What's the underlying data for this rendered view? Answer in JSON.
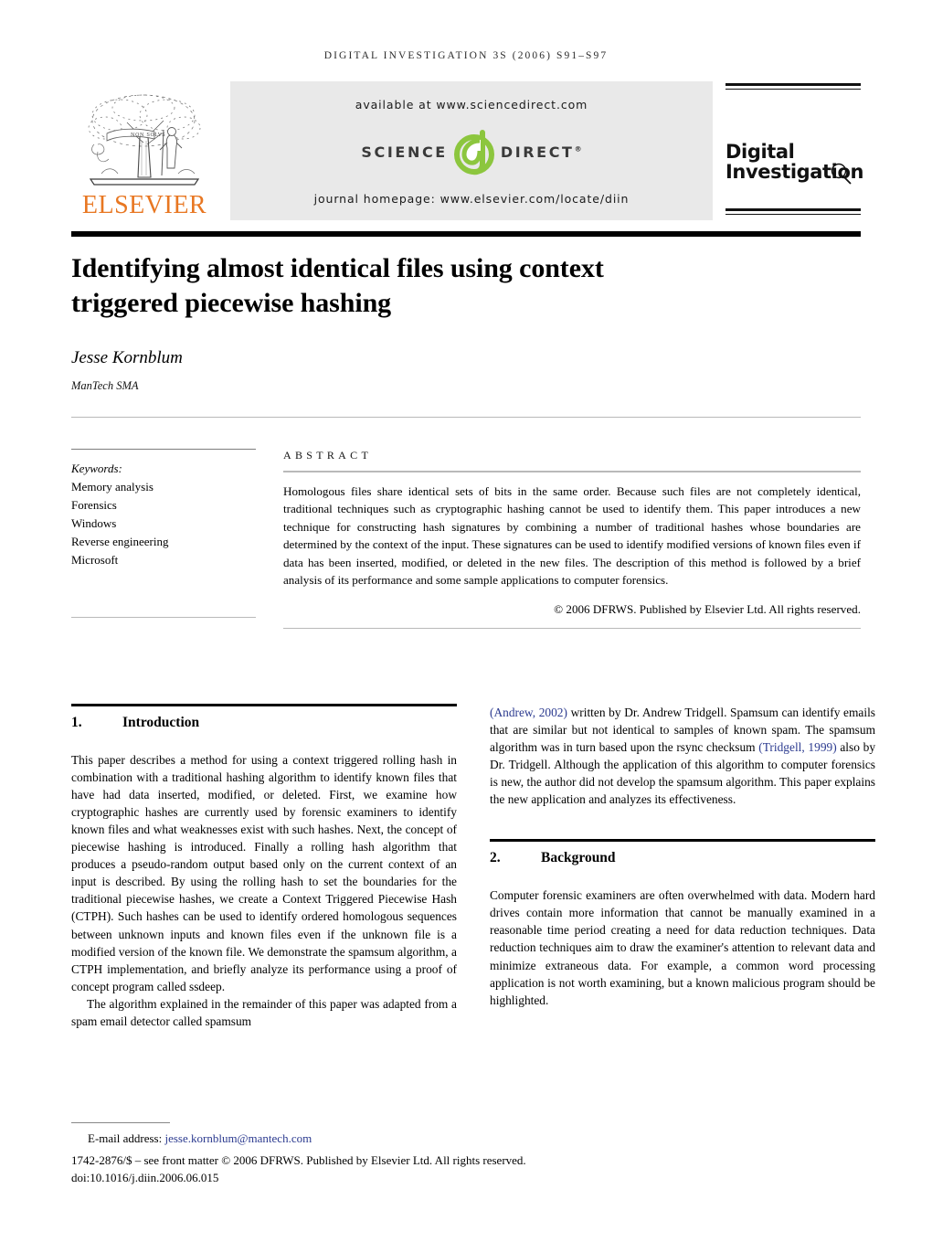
{
  "running_head": "DIGITAL INVESTIGATION 3S (2006) S91–S97",
  "masthead": {
    "elsevier_wordmark": "ELSEVIER",
    "elsevier_motto": "NON SOLVS",
    "available_at": "available at www.sciencedirect.com",
    "sciencedirect_left": "SCIENCE",
    "sciencedirect_right": "DIRECT",
    "sciencedirect_mark": "d",
    "journal_homepage": "journal homepage: www.elsevier.com/locate/diin",
    "journal_name_line1": "Digital",
    "journal_name_line2": "Investigation"
  },
  "article": {
    "title": "Identifying almost identical files using context triggered piecewise hashing",
    "author": "Jesse Kornblum",
    "affiliation": "ManTech SMA"
  },
  "keywords": {
    "label": "Keywords:",
    "items": [
      "Memory analysis",
      "Forensics",
      "Windows",
      "Reverse engineering",
      "Microsoft"
    ]
  },
  "abstract": {
    "heading": "ABSTRACT",
    "text": "Homologous files share identical sets of bits in the same order. Because such files are not completely identical, traditional techniques such as cryptographic hashing cannot be used to identify them. This paper introduces a new technique for constructing hash signatures by combining a number of traditional hashes whose boundaries are determined by the context of the input. These signatures can be used to identify modified versions of known files even if data has been inserted, modified, or deleted in the new files. The description of this method is followed by a brief analysis of its performance and some sample applications to computer forensics.",
    "rights": "© 2006 DFRWS. Published by Elsevier Ltd. All rights reserved."
  },
  "sections": {
    "introduction": {
      "number": "1.",
      "title": "Introduction",
      "paragraph_1": "This paper describes a method for using a context triggered rolling hash in combination with a traditional hashing algorithm to identify known files that have had data inserted, modified, or deleted. First, we examine how cryptographic hashes are currently used by forensic examiners to identify known files and what weaknesses exist with such hashes. Next, the concept of piecewise hashing is introduced. Finally a rolling hash algorithm that produces a pseudo-random output based only on the current context of an input is described. By using the rolling hash to set the boundaries for the traditional piecewise hashes, we create a Context Triggered Piecewise Hash (CTPH). Such hashes can be used to identify ordered homologous sequences between unknown inputs and known files even if the unknown file is a modified version of the known file. We demonstrate the spamsum algorithm, a CTPH implementation, and briefly analyze its performance using a proof of concept program called ssdeep.",
      "paragraph_2_part_1": "The algorithm explained in the remainder of this paper was adapted from a spam email detector called spamsum",
      "paragraph_2_cite_1": "(Andrew, 2002)",
      "paragraph_2_part_2": " written by Dr. Andrew Tridgell. Spamsum can identify emails that are similar but not identical to samples of known spam. The spamsum algorithm was in turn based upon the rsync checksum ",
      "paragraph_2_cite_2": "(Tridgell, 1999)",
      "paragraph_2_part_3": " also by Dr. Tridgell. Although the application of this algorithm to computer forensics is new, the author did not develop the spamsum algorithm. This paper explains the new application and analyzes its effectiveness."
    },
    "background": {
      "number": "2.",
      "title": "Background",
      "paragraph_1": "Computer forensic examiners are often overwhelmed with data. Modern hard drives contain more information that cannot be manually examined in a reasonable time period creating a need for data reduction techniques. Data reduction techniques aim to draw the examiner's attention to relevant data and minimize extraneous data. For example, a common word processing application is not worth examining, but a known malicious program should be highlighted."
    }
  },
  "footer": {
    "email_label": "E-mail address:",
    "email_address": "jesse.kornblum@mantech.com",
    "front_matter": "1742-2876/$ – see front matter © 2006 DFRWS. Published by Elsevier Ltd. All rights reserved.",
    "doi": "doi:10.1016/j.diin.2006.06.015"
  },
  "colors": {
    "elsevier_orange": "#E87722",
    "sciencedirect_green": "#8CC63E",
    "link_blue": "#2b3a8f",
    "band_gray": "#e9e9e9"
  }
}
